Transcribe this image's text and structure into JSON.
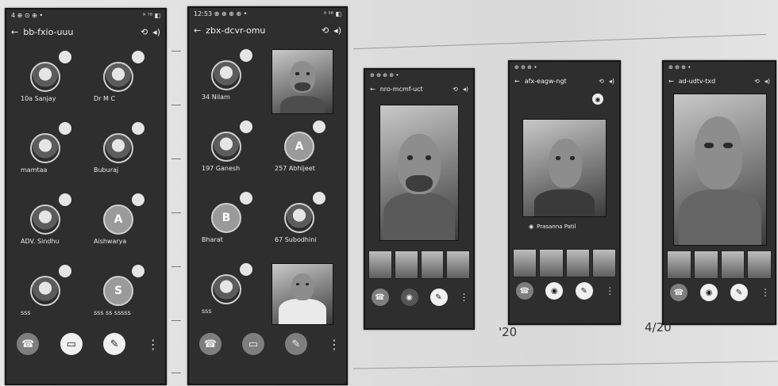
{
  "phones": [
    {
      "status_left": "4 ⊕ ⊙ ⊕ •",
      "status_right": "⁹ ⁷⁸ ◧",
      "title": "bb-fxio-uuu",
      "tiles": [
        {
          "label": "10a Sanjay",
          "avatar": ""
        },
        {
          "label": "Dr M C",
          "avatar": ""
        },
        {
          "label": "mamtaa",
          "avatar": ""
        },
        {
          "label": "Buburaj",
          "avatar": ""
        },
        {
          "label": "ADV. Sindhu",
          "avatar": ""
        },
        {
          "label": "Aishwarya",
          "avatar": "A"
        },
        {
          "label": "sss",
          "avatar": ""
        },
        {
          "label": "sss ss sssss",
          "avatar": "S"
        }
      ]
    },
    {
      "status_left": "12:53 ⊕ ⊕ ⊕ ⊕ •",
      "status_right": "⁹ ⁵⁸ ◧",
      "title": "zbx-dcvr-omu",
      "tiles": [
        {
          "label": "34 Nilam",
          "avatar": ""
        },
        {
          "label": "197 Ganesh",
          "avatar": ""
        },
        {
          "label": "257 Abhijeet",
          "avatar": "A"
        },
        {
          "label": "Bharat",
          "avatar": "B"
        },
        {
          "label": "67 Subodhini",
          "avatar": ""
        },
        {
          "label": "sss",
          "avatar": ""
        }
      ]
    },
    {
      "status_left": "⊕ ⊕ ⊕ ⊕ •",
      "title": "nro-mcmf-uct"
    },
    {
      "status_left": "⊕ ⊕ ⊕ •",
      "title": "afx-eagw-ngt",
      "speaker": "Prasanna Patil"
    },
    {
      "status_left": "⊕ ⊕ ⊕ •",
      "title": "ad-udtv-txd"
    }
  ],
  "captions": {
    "phone4": "'20",
    "phone5": "4/20"
  },
  "icons": {
    "back": "back-arrow-icon",
    "camera_switch": "camera-switch-icon",
    "speaker": "speaker-icon",
    "end_call": "end-call-icon",
    "video_off": "video-off-icon",
    "mic_off": "mic-off-icon",
    "more": "more-vert-icon"
  }
}
